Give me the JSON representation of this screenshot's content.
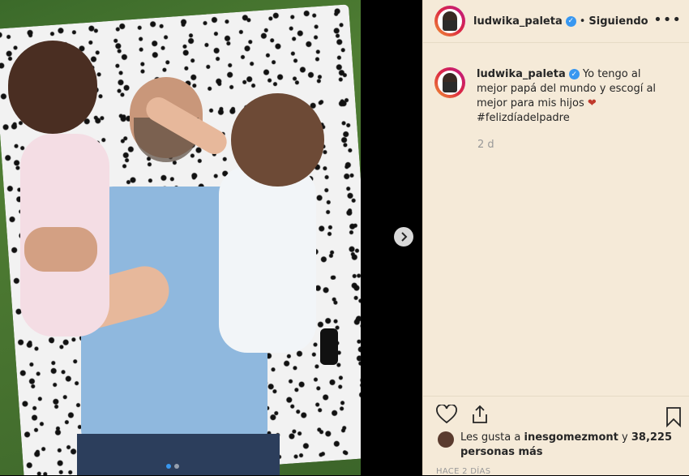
{
  "post": {
    "username": "ludwika_paleta",
    "follow_status": "Siguiendo",
    "separator": "•",
    "more": "•••",
    "caption_user": "ludwika_paleta",
    "caption_text": "Yo tengo al mejor papá del mundo y escogí al mejor para mis hijos",
    "caption_emoji": "❤",
    "hashtag": "#felizdíadelpadre",
    "caption_age": "2 d",
    "liked_by_prefix": "Les gusta a",
    "liked_by_user": "inesgomezmont",
    "liked_by_conj": "y",
    "likes_count": "38,225 personas más",
    "timestamp": "HACE 2 DÍAS"
  },
  "carousel": {
    "next_icon": "chevron-right-icon",
    "dot_count": 2,
    "active_dot": 0
  },
  "icons": {
    "verified": "verified-badge-icon",
    "like": "heart-outline-icon",
    "share": "share-upload-icon",
    "save": "bookmark-icon"
  },
  "colors": {
    "panel_bg": "#f5ead8",
    "verified": "#3897f0",
    "text": "#262626",
    "muted": "#999999"
  }
}
